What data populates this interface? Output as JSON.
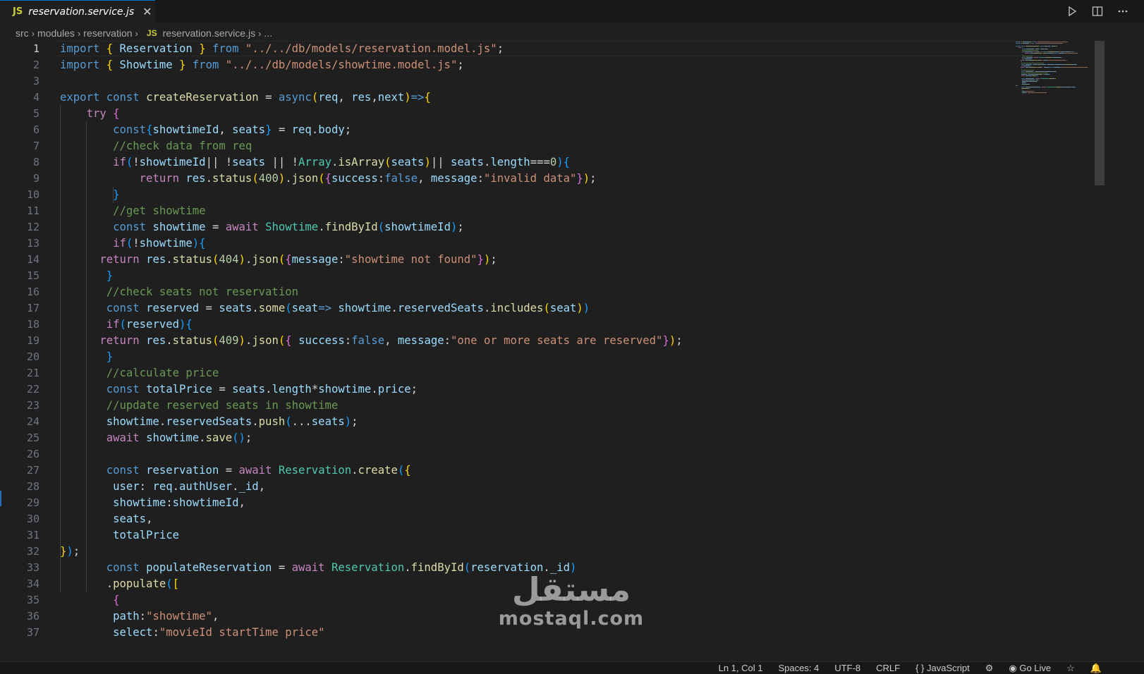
{
  "tab": {
    "lang_badge": "JS",
    "filename": "reservation.service.js",
    "close_glyph": "✕"
  },
  "breadcrumb": {
    "items": [
      "src",
      "modules",
      "reservation"
    ],
    "lang_badge": "JS",
    "file": "reservation.service.js",
    "ellipsis": "..."
  },
  "editor": {
    "active_line": 1,
    "lines": [
      [
        [
          "k",
          "import"
        ],
        [
          "p",
          " "
        ],
        [
          "b1",
          "{"
        ],
        [
          "p",
          " "
        ],
        [
          "v",
          "Reservation"
        ],
        [
          "p",
          " "
        ],
        [
          "b1",
          "}"
        ],
        [
          "p",
          " "
        ],
        [
          "k",
          "from"
        ],
        [
          "p",
          " "
        ],
        [
          "s",
          "\"../../db/models/reservation.model.js\""
        ],
        [
          "p",
          ";"
        ]
      ],
      [
        [
          "k",
          "import"
        ],
        [
          "p",
          " "
        ],
        [
          "b1",
          "{"
        ],
        [
          "p",
          " "
        ],
        [
          "v",
          "Showtime"
        ],
        [
          "p",
          " "
        ],
        [
          "b1",
          "}"
        ],
        [
          "p",
          " "
        ],
        [
          "k",
          "from"
        ],
        [
          "p",
          " "
        ],
        [
          "s",
          "\"../../db/models/showtime.model.js\""
        ],
        [
          "p",
          ";"
        ]
      ],
      [],
      [
        [
          "k",
          "export"
        ],
        [
          "p",
          " "
        ],
        [
          "k",
          "const"
        ],
        [
          "p",
          " "
        ],
        [
          "f",
          "createReservation"
        ],
        [
          "p",
          " = "
        ],
        [
          "k",
          "async"
        ],
        [
          "b1",
          "("
        ],
        [
          "v",
          "req"
        ],
        [
          "p",
          ", "
        ],
        [
          "v",
          "res"
        ],
        [
          "p",
          ","
        ],
        [
          "v",
          "next"
        ],
        [
          "b1",
          ")"
        ],
        [
          "k",
          "=>"
        ],
        [
          "b1",
          "{"
        ]
      ],
      [
        [
          "p",
          "    "
        ],
        [
          "kc",
          "try"
        ],
        [
          "p",
          " "
        ],
        [
          "b2",
          "{"
        ]
      ],
      [
        [
          "p",
          "        "
        ],
        [
          "k",
          "const"
        ],
        [
          "b3",
          "{"
        ],
        [
          "v",
          "showtimeId"
        ],
        [
          "p",
          ", "
        ],
        [
          "v",
          "seats"
        ],
        [
          "b3",
          "}"
        ],
        [
          "p",
          " = "
        ],
        [
          "v",
          "req"
        ],
        [
          "p",
          "."
        ],
        [
          "v",
          "body"
        ],
        [
          "p",
          ";"
        ]
      ],
      [
        [
          "p",
          "        "
        ],
        [
          "c",
          "//check data from req"
        ]
      ],
      [
        [
          "p",
          "        "
        ],
        [
          "kc",
          "if"
        ],
        [
          "b3",
          "("
        ],
        [
          "p",
          "!"
        ],
        [
          "v",
          "showtimeId"
        ],
        [
          "p",
          "|| !"
        ],
        [
          "v",
          "seats"
        ],
        [
          "p",
          " || !"
        ],
        [
          "t",
          "Array"
        ],
        [
          "p",
          "."
        ],
        [
          "f",
          "isArray"
        ],
        [
          "b1",
          "("
        ],
        [
          "v",
          "seats"
        ],
        [
          "b1",
          ")"
        ],
        [
          "p",
          "|| "
        ],
        [
          "v",
          "seats"
        ],
        [
          "p",
          "."
        ],
        [
          "v",
          "length"
        ],
        [
          "p",
          "==="
        ],
        [
          "n",
          "0"
        ],
        [
          "b3",
          ")"
        ],
        [
          "b3",
          "{"
        ]
      ],
      [
        [
          "p",
          "            "
        ],
        [
          "kc",
          "return"
        ],
        [
          "p",
          " "
        ],
        [
          "v",
          "res"
        ],
        [
          "p",
          "."
        ],
        [
          "f",
          "status"
        ],
        [
          "b1",
          "("
        ],
        [
          "n",
          "400"
        ],
        [
          "b1",
          ")"
        ],
        [
          "p",
          "."
        ],
        [
          "f",
          "json"
        ],
        [
          "b1",
          "("
        ],
        [
          "b2",
          "{"
        ],
        [
          "v",
          "success"
        ],
        [
          "p",
          ":"
        ],
        [
          "k",
          "false"
        ],
        [
          "p",
          ", "
        ],
        [
          "v",
          "message"
        ],
        [
          "p",
          ":"
        ],
        [
          "s",
          "\"invalid data\""
        ],
        [
          "b2",
          "}"
        ],
        [
          "b1",
          ")"
        ],
        [
          "p",
          ";"
        ]
      ],
      [
        [
          "p",
          "        "
        ],
        [
          "b3",
          "}"
        ]
      ],
      [
        [
          "p",
          "        "
        ],
        [
          "c",
          "//get showtime"
        ]
      ],
      [
        [
          "p",
          "        "
        ],
        [
          "k",
          "const"
        ],
        [
          "p",
          " "
        ],
        [
          "v",
          "showtime"
        ],
        [
          "p",
          " = "
        ],
        [
          "kc",
          "await"
        ],
        [
          "p",
          " "
        ],
        [
          "t",
          "Showtime"
        ],
        [
          "p",
          "."
        ],
        [
          "f",
          "findById"
        ],
        [
          "b3",
          "("
        ],
        [
          "v",
          "showtimeId"
        ],
        [
          "b3",
          ")"
        ],
        [
          "p",
          ";"
        ]
      ],
      [
        [
          "p",
          "        "
        ],
        [
          "kc",
          "if"
        ],
        [
          "b3",
          "("
        ],
        [
          "p",
          "!"
        ],
        [
          "v",
          "showtime"
        ],
        [
          "b3",
          ")"
        ],
        [
          "b3",
          "{"
        ]
      ],
      [
        [
          "p",
          "      "
        ],
        [
          "kc",
          "return"
        ],
        [
          "p",
          " "
        ],
        [
          "v",
          "res"
        ],
        [
          "p",
          "."
        ],
        [
          "f",
          "status"
        ],
        [
          "b1",
          "("
        ],
        [
          "n",
          "404"
        ],
        [
          "b1",
          ")"
        ],
        [
          "p",
          "."
        ],
        [
          "f",
          "json"
        ],
        [
          "b1",
          "("
        ],
        [
          "b2",
          "{"
        ],
        [
          "v",
          "message"
        ],
        [
          "p",
          ":"
        ],
        [
          "s",
          "\"showtime not found\""
        ],
        [
          "b2",
          "}"
        ],
        [
          "b1",
          ")"
        ],
        [
          "p",
          ";"
        ]
      ],
      [
        [
          "p",
          "       "
        ],
        [
          "b3",
          "}"
        ]
      ],
      [
        [
          "p",
          "       "
        ],
        [
          "c",
          "//check seats not reservation"
        ]
      ],
      [
        [
          "p",
          "       "
        ],
        [
          "k",
          "const"
        ],
        [
          "p",
          " "
        ],
        [
          "v",
          "reserved"
        ],
        [
          "p",
          " = "
        ],
        [
          "v",
          "seats"
        ],
        [
          "p",
          "."
        ],
        [
          "f",
          "some"
        ],
        [
          "b3",
          "("
        ],
        [
          "v",
          "seat"
        ],
        [
          "k",
          "=>"
        ],
        [
          "p",
          " "
        ],
        [
          "v",
          "showtime"
        ],
        [
          "p",
          "."
        ],
        [
          "v",
          "reservedSeats"
        ],
        [
          "p",
          "."
        ],
        [
          "f",
          "includes"
        ],
        [
          "b1",
          "("
        ],
        [
          "v",
          "seat"
        ],
        [
          "b1",
          ")"
        ],
        [
          "b3",
          ")"
        ]
      ],
      [
        [
          "p",
          "       "
        ],
        [
          "kc",
          "if"
        ],
        [
          "b3",
          "("
        ],
        [
          "v",
          "reserved"
        ],
        [
          "b3",
          ")"
        ],
        [
          "b3",
          "{"
        ]
      ],
      [
        [
          "p",
          "      "
        ],
        [
          "kc",
          "return"
        ],
        [
          "p",
          " "
        ],
        [
          "v",
          "res"
        ],
        [
          "p",
          "."
        ],
        [
          "f",
          "status"
        ],
        [
          "b1",
          "("
        ],
        [
          "n",
          "409"
        ],
        [
          "b1",
          ")"
        ],
        [
          "p",
          "."
        ],
        [
          "f",
          "json"
        ],
        [
          "b1",
          "("
        ],
        [
          "b2",
          "{"
        ],
        [
          "p",
          " "
        ],
        [
          "v",
          "success"
        ],
        [
          "p",
          ":"
        ],
        [
          "k",
          "false"
        ],
        [
          "p",
          ", "
        ],
        [
          "v",
          "message"
        ],
        [
          "p",
          ":"
        ],
        [
          "s",
          "\"one or more seats are reserved\""
        ],
        [
          "b2",
          "}"
        ],
        [
          "b1",
          ")"
        ],
        [
          "p",
          ";"
        ]
      ],
      [
        [
          "p",
          "       "
        ],
        [
          "b3",
          "}"
        ]
      ],
      [
        [
          "p",
          "       "
        ],
        [
          "c",
          "//calculate price"
        ]
      ],
      [
        [
          "p",
          "       "
        ],
        [
          "k",
          "const"
        ],
        [
          "p",
          " "
        ],
        [
          "v",
          "totalPrice"
        ],
        [
          "p",
          " = "
        ],
        [
          "v",
          "seats"
        ],
        [
          "p",
          "."
        ],
        [
          "v",
          "length"
        ],
        [
          "p",
          "*"
        ],
        [
          "v",
          "showtime"
        ],
        [
          "p",
          "."
        ],
        [
          "v",
          "price"
        ],
        [
          "p",
          ";"
        ]
      ],
      [
        [
          "p",
          "       "
        ],
        [
          "c",
          "//update reserved seats in showtime"
        ]
      ],
      [
        [
          "p",
          "       "
        ],
        [
          "v",
          "showtime"
        ],
        [
          "p",
          "."
        ],
        [
          "v",
          "reservedSeats"
        ],
        [
          "p",
          "."
        ],
        [
          "f",
          "push"
        ],
        [
          "b3",
          "("
        ],
        [
          "p",
          "..."
        ],
        [
          "v",
          "seats"
        ],
        [
          "b3",
          ")"
        ],
        [
          "p",
          ";"
        ]
      ],
      [
        [
          "p",
          "       "
        ],
        [
          "kc",
          "await"
        ],
        [
          "p",
          " "
        ],
        [
          "v",
          "showtime"
        ],
        [
          "p",
          "."
        ],
        [
          "f",
          "save"
        ],
        [
          "b3",
          "("
        ],
        [
          "b3",
          ")"
        ],
        [
          "p",
          ";"
        ]
      ],
      [],
      [
        [
          "p",
          "       "
        ],
        [
          "k",
          "const"
        ],
        [
          "p",
          " "
        ],
        [
          "v",
          "reservation"
        ],
        [
          "p",
          " = "
        ],
        [
          "kc",
          "await"
        ],
        [
          "p",
          " "
        ],
        [
          "t",
          "Reservation"
        ],
        [
          "p",
          "."
        ],
        [
          "f",
          "create"
        ],
        [
          "b3",
          "("
        ],
        [
          "b1",
          "{"
        ]
      ],
      [
        [
          "p",
          "        "
        ],
        [
          "v",
          "user"
        ],
        [
          "p",
          ": "
        ],
        [
          "v",
          "req"
        ],
        [
          "p",
          "."
        ],
        [
          "v",
          "authUser"
        ],
        [
          "p",
          "."
        ],
        [
          "v",
          "_id"
        ],
        [
          "p",
          ","
        ]
      ],
      [
        [
          "p",
          "        "
        ],
        [
          "v",
          "showtime"
        ],
        [
          "p",
          ":"
        ],
        [
          "v",
          "showtimeId"
        ],
        [
          "p",
          ","
        ]
      ],
      [
        [
          "p",
          "        "
        ],
        [
          "v",
          "seats"
        ],
        [
          "p",
          ","
        ]
      ],
      [
        [
          "p",
          "        "
        ],
        [
          "v",
          "totalPrice"
        ]
      ],
      [
        [
          "b1",
          "}"
        ],
        [
          "b3",
          ")"
        ],
        [
          "p",
          ";"
        ]
      ],
      [
        [
          "p",
          "       "
        ],
        [
          "k",
          "const"
        ],
        [
          "p",
          " "
        ],
        [
          "v",
          "populateReservation"
        ],
        [
          "p",
          " = "
        ],
        [
          "kc",
          "await"
        ],
        [
          "p",
          " "
        ],
        [
          "t",
          "Reservation"
        ],
        [
          "p",
          "."
        ],
        [
          "f",
          "findById"
        ],
        [
          "b3",
          "("
        ],
        [
          "v",
          "reservation"
        ],
        [
          "p",
          "."
        ],
        [
          "v",
          "_id"
        ],
        [
          "b3",
          ")"
        ]
      ],
      [
        [
          "p",
          "       ."
        ],
        [
          "f",
          "populate"
        ],
        [
          "b3",
          "("
        ],
        [
          "b1",
          "["
        ]
      ],
      [
        [
          "p",
          "        "
        ],
        [
          "b2",
          "{"
        ]
      ],
      [
        [
          "p",
          "        "
        ],
        [
          "v",
          "path"
        ],
        [
          "p",
          ":"
        ],
        [
          "s",
          "\"showtime\""
        ],
        [
          "p",
          ","
        ]
      ],
      [
        [
          "p",
          "        "
        ],
        [
          "v",
          "select"
        ],
        [
          "p",
          ":"
        ],
        [
          "s",
          "\"movieId startTime price\""
        ]
      ]
    ]
  },
  "status": {
    "position": "Ln 1, Col 1",
    "spaces": "Spaces: 4",
    "encoding": "UTF-8",
    "eol": "CRLF",
    "language": "JavaScript",
    "golive": "Go Live"
  },
  "watermark": {
    "arabic": "مستقل",
    "latin": "mostaql.com"
  },
  "colors": {
    "accent": "#0078d4",
    "keyword": "#569cd6",
    "control": "#c586c0",
    "variable": "#9cdcfe",
    "type": "#4ec9b0",
    "string": "#ce9178",
    "number": "#b5cea8",
    "comment": "#6a9955",
    "function": "#dcdcaa"
  }
}
